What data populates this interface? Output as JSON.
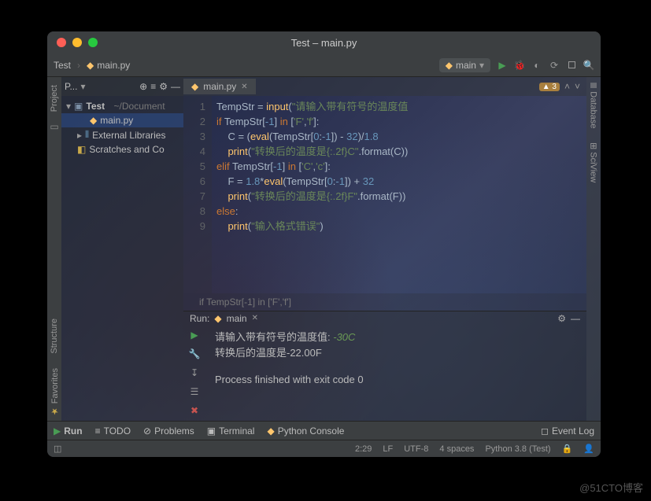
{
  "window": {
    "title": "Test – main.py"
  },
  "breadcrumbs": {
    "project": "Test",
    "file": "main.py"
  },
  "run_config": {
    "label": "main"
  },
  "project_panel": {
    "header": "P...",
    "root": "Test",
    "root_path": "~/Document",
    "file": "main.py",
    "ext_lib": "External Libraries",
    "scratches": "Scratches and Co"
  },
  "editor": {
    "tab": "main.py",
    "warn_count": "3",
    "lines": [
      {
        "n": "1",
        "html": "TempStr = <span class='f'>input</span>(<span class='s'>\"请输入带有符号的温度值</span>"
      },
      {
        "n": "2",
        "html": "<span class='k'>if</span> TempStr[<span class='n'>-1</span>] <span class='k'>in</span> [<span class='s'>'F'</span>,<span class='s'>'f'</span>]:"
      },
      {
        "n": "3",
        "html": "    C = (<span class='f'>eval</span>(TempStr[<span class='n'>0</span>:<span class='n'>-1</span>]) - <span class='n'>32</span>)/<span class='n'>1.8</span>"
      },
      {
        "n": "4",
        "html": "    <span class='f'>print</span>(<span class='s'>\"转换后的温度是{:.2f}C\"</span>.format(C))"
      },
      {
        "n": "5",
        "html": "<span class='k'>elif</span> TempStr[<span class='n'>-1</span>] <span class='k'>in</span> [<span class='s'>'C'</span>,<span class='s'>'c'</span>]:"
      },
      {
        "n": "6",
        "html": "    F = <span class='n'>1.8</span>*<span class='f'>eval</span>(TempStr[<span class='n'>0</span>:<span class='n'>-1</span>]) + <span class='n'>32</span>"
      },
      {
        "n": "7",
        "html": "    <span class='f'>print</span>(<span class='s'>\"转换后的温度是{:.2f}F\"</span>.format(F))"
      },
      {
        "n": "8",
        "html": "<span class='k'>else</span>:"
      },
      {
        "n": "9",
        "html": "    <span class='f'>print</span>(<span class='s'>\"输入格式错误\"</span>)"
      }
    ],
    "breadcrumb_hint": "if TempStr[-1] in ['F','f']"
  },
  "run_panel": {
    "label": "Run:",
    "config": "main",
    "out_line1_prefix": "请输入带有符号的温度值: ",
    "out_line1_input": "-30C",
    "out_line2": "转换后的温度是-22.00F",
    "out_line3": "Process finished with exit code 0"
  },
  "bottom_tabs": {
    "run": "Run",
    "todo": "TODO",
    "problems": "Problems",
    "terminal": "Terminal",
    "python_console": "Python Console",
    "event_log": "Event Log"
  },
  "status": {
    "pos": "2:29",
    "lf": "LF",
    "enc": "UTF-8",
    "indent": "4 spaces",
    "interp": "Python 3.8 (Test)"
  },
  "side_tabs": {
    "project": "Project",
    "structure": "Structure",
    "favorites": "Favorites",
    "database": "Database",
    "sciview": "SciView"
  },
  "watermark": "@51CTO博客"
}
